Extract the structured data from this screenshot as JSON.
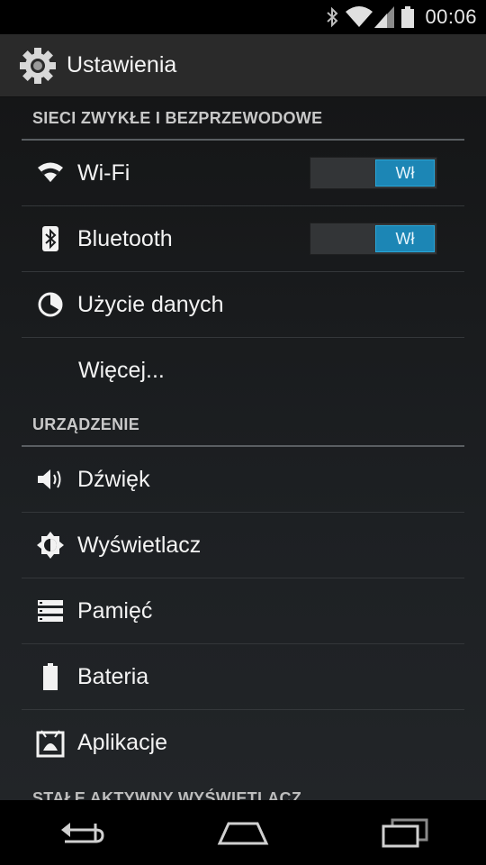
{
  "status_bar": {
    "time": "00:06",
    "icons": [
      "bluetooth-icon",
      "wifi-signal-icon",
      "cell-signal-icon",
      "battery-icon"
    ]
  },
  "action_bar": {
    "title": "Ustawienia",
    "icon": "gear-icon"
  },
  "sections": [
    {
      "header": "SIECI ZWYKŁE I BEZPRZEWODOWE",
      "items": [
        {
          "label": "Wi-Fi",
          "icon": "wifi-icon",
          "toggle": "Wł"
        },
        {
          "label": "Bluetooth",
          "icon": "bluetooth-icon",
          "toggle": "Wł"
        },
        {
          "label": "Użycie danych",
          "icon": "data-usage-icon"
        },
        {
          "label": "Więcej...",
          "icon": null
        }
      ]
    },
    {
      "header": "URZĄDZENIE",
      "items": [
        {
          "label": "Dźwięk",
          "icon": "speaker-icon"
        },
        {
          "label": "Wyświetlacz",
          "icon": "brightness-icon"
        },
        {
          "label": "Pamięć",
          "icon": "storage-icon"
        },
        {
          "label": "Bateria",
          "icon": "battery-icon"
        },
        {
          "label": "Aplikacje",
          "icon": "apps-icon"
        }
      ]
    },
    {
      "header": "STAŁE AKTYWNY WYŚWIETLACZ"
    }
  ],
  "nav_bar": {
    "buttons": [
      "back-icon",
      "home-icon",
      "recents-icon"
    ]
  },
  "colors": {
    "accent": "#1c86b5",
    "action_bar": "#2a2a2a",
    "background": "#1d2023"
  }
}
